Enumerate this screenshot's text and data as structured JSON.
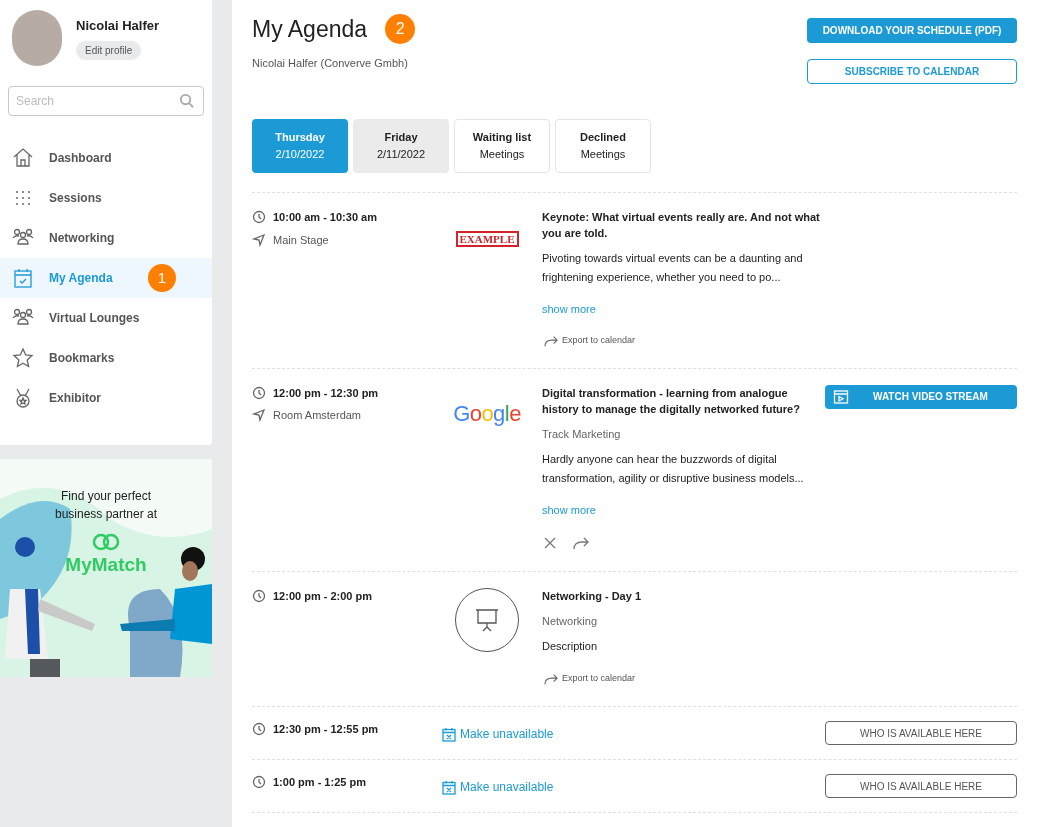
{
  "profile": {
    "name": "Nicolai Halfer",
    "edit_label": "Edit profile"
  },
  "search": {
    "placeholder": "Search"
  },
  "nav": [
    {
      "label": "Dashboard",
      "selected": false
    },
    {
      "label": "Sessions",
      "selected": false
    },
    {
      "label": "Networking",
      "selected": false
    },
    {
      "label": "My Agenda",
      "selected": true,
      "badge": "1"
    },
    {
      "label": "Virtual Lounges",
      "selected": false
    },
    {
      "label": "Bookmarks",
      "selected": false
    },
    {
      "label": "Exhibitor",
      "selected": false
    }
  ],
  "banner": {
    "text": "Find your perfect business partner at",
    "brand": "MyMatch"
  },
  "header": {
    "title": "My Agenda",
    "badge": "2",
    "subtitle": "Nicolai Halfer (Converve Gmbh)"
  },
  "header_buttons": [
    {
      "kind": "primary",
      "label": "DOWNLOAD YOUR SCHEDULE (PDF)"
    },
    {
      "kind": "outline",
      "label": "SUBSCRIBE TO CALENDAR"
    }
  ],
  "tabs": [
    {
      "kind": "day",
      "line1": "Thursday",
      "line2": "2/10/2022",
      "selected": true
    },
    {
      "kind": "day",
      "line1": "Friday",
      "line2": "2/11/2022",
      "selected": false
    },
    {
      "kind": "list",
      "line1": "Waiting list",
      "line2": "Meetings",
      "selected": false
    },
    {
      "kind": "list",
      "line1": "Declined",
      "line2": "Meetings",
      "selected": false
    }
  ],
  "agenda": [
    {
      "kind": "session",
      "time": "10:00 am - 10:30 am",
      "location": "Main Stage",
      "image_text": "EXAMPLE",
      "title": "Keynote: What virtual events really are. And not what you are told.",
      "description": "Pivoting towards virtual events can be a daunting and frightening experience, whether you need to po...",
      "show_more": "show more",
      "export": "Export to calendar"
    },
    {
      "kind": "session",
      "time": "12:00 pm - 12:30 pm",
      "location": "Room Amsterdam",
      "image_text": "Google",
      "title": "Digital transformation - learning from analogue history to manage the digitally networked future?",
      "track": "Track Marketing",
      "description": "Hardly anyone can hear the buzzwords of digital transformation, agility or disruptive business models...",
      "show_more": "show more",
      "watch": "WATCH VIDEO STREAM",
      "icon_actions": true
    },
    {
      "kind": "session",
      "time": "12:00 pm - 2:00 pm",
      "title": "Networking - Day 1",
      "track": "Networking",
      "description": "Description",
      "export": "Export to calendar"
    },
    {
      "kind": "slot",
      "time": "12:30 pm - 12:55 pm",
      "action": "Make unavailable",
      "button": "WHO IS AVAILABLE HERE"
    },
    {
      "kind": "slot",
      "time": "1:00 pm - 1:25 pm",
      "action": "Make unavailable",
      "button": "WHO IS AVAILABLE HERE"
    }
  ]
}
